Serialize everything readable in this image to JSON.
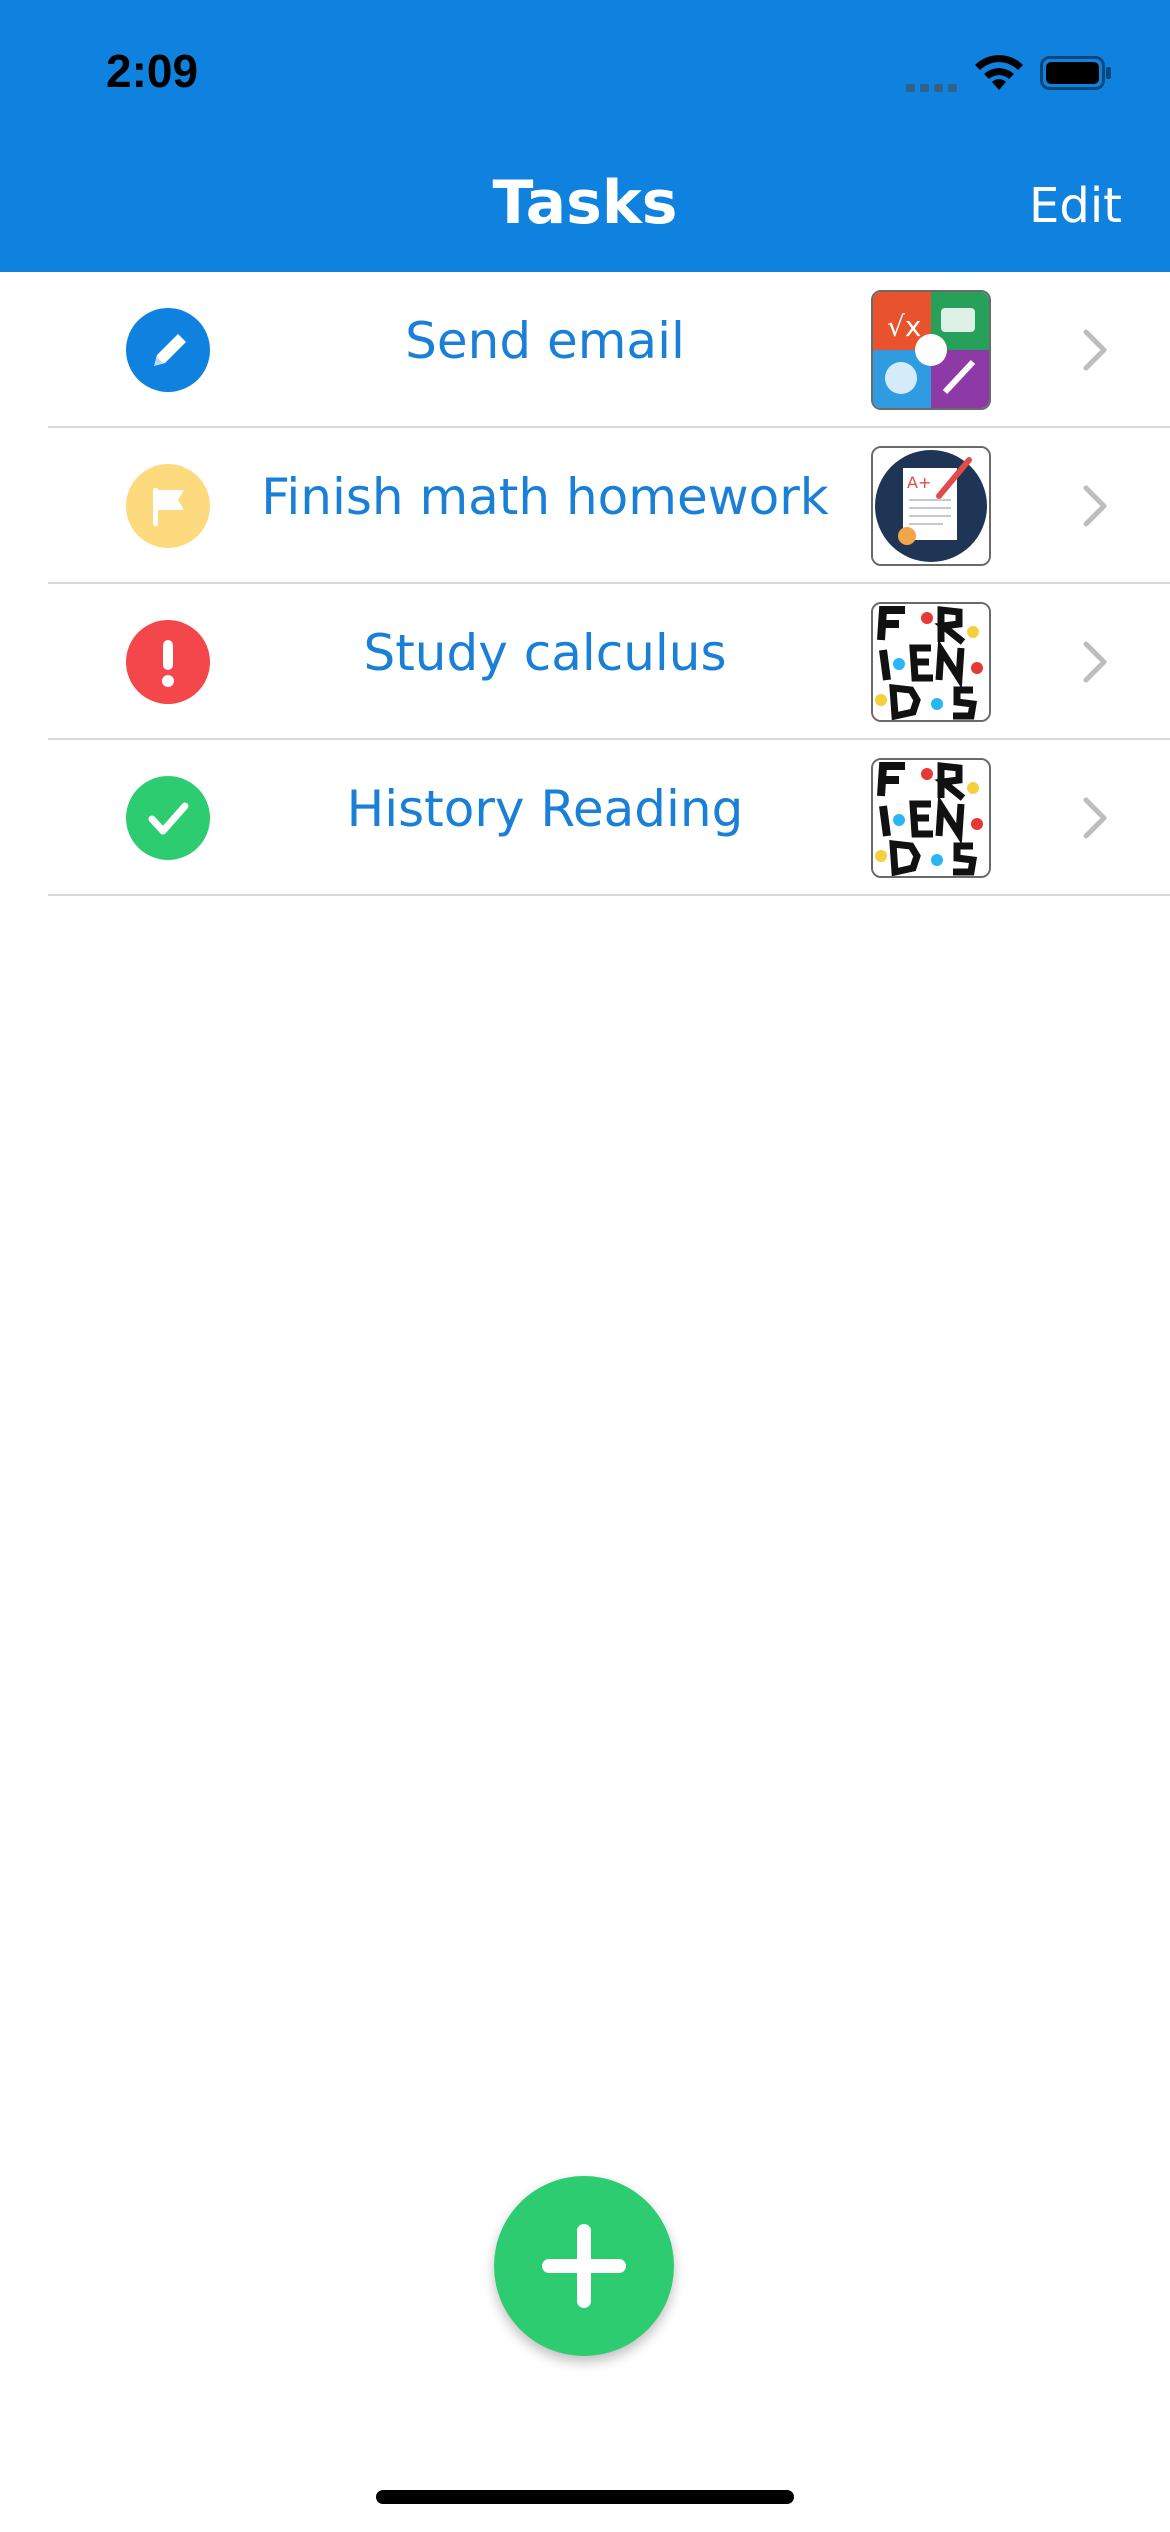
{
  "status_bar": {
    "time": "2:09"
  },
  "nav": {
    "title": "Tasks",
    "edit_label": "Edit"
  },
  "tasks": [
    {
      "label": "Send email",
      "status_icon": "pencil-icon",
      "status_color": "#0F82DF",
      "thumbnail": "subjects-collage"
    },
    {
      "label": "Finish math homework",
      "status_icon": "flag-icon",
      "status_color": "#FDDA7E",
      "thumbnail": "graded-paper"
    },
    {
      "label": "Study calculus",
      "status_icon": "exclamation-icon",
      "status_color": "#F4474B",
      "thumbnail": "friends-logo"
    },
    {
      "label": "History Reading",
      "status_icon": "checkmark-icon",
      "status_color": "#2ECC71",
      "thumbnail": "friends-logo"
    }
  ],
  "fab": {
    "icon": "plus-icon",
    "color": "#2ECC71"
  },
  "colors": {
    "header": "#0F82DF",
    "label": "#1A7FD6"
  }
}
